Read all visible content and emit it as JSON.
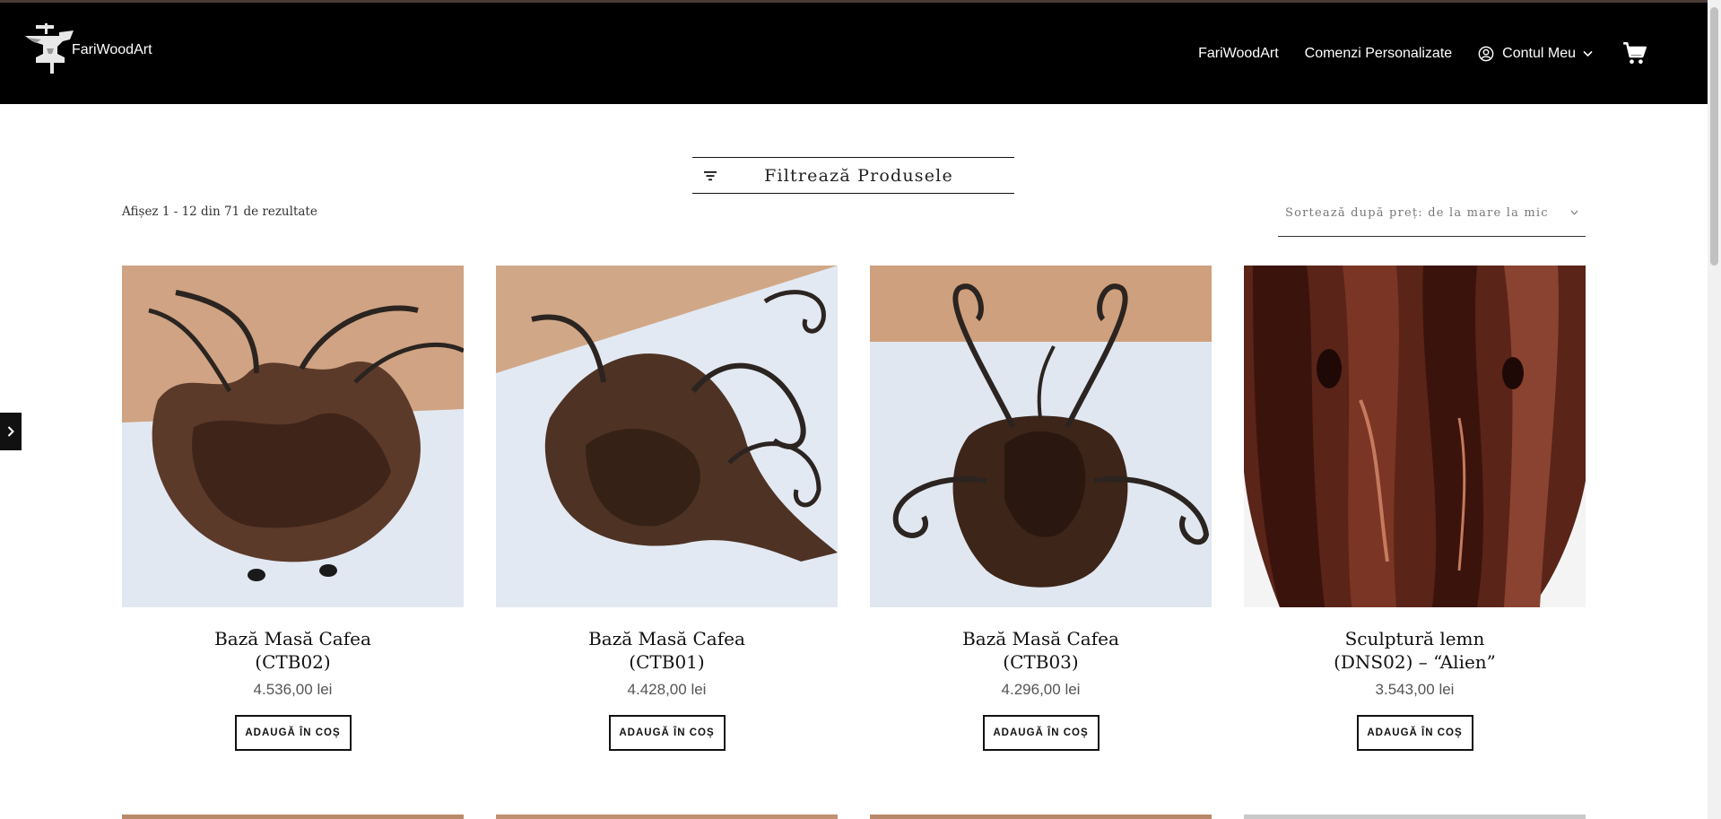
{
  "brand": {
    "name": "FariWoodArt"
  },
  "nav": {
    "items": [
      {
        "label": "FariWoodArt"
      },
      {
        "label": "Comenzi Personalizate"
      },
      {
        "label": "Contul Meu"
      }
    ]
  },
  "toolbar": {
    "filter_label": "Filtrează Produsele",
    "result_count": "Afișez 1 - 12 din 71 de rezultate",
    "sort_label": "Sortează după preț: de la mare la mic"
  },
  "products": [
    {
      "title_line1": "Bază Masă Cafea",
      "title_line2": "(CTB02)",
      "price": "4.536,00 lei",
      "button": "ADAUGĂ ÎN COȘ"
    },
    {
      "title_line1": "Bază Masă Cafea",
      "title_line2": "(CTB01)",
      "price": "4.428,00 lei",
      "button": "ADAUGĂ ÎN COȘ"
    },
    {
      "title_line1": "Bază Masă Cafea",
      "title_line2": "(CTB03)",
      "price": "4.296,00 lei",
      "button": "ADAUGĂ ÎN COȘ"
    },
    {
      "title_line1": "Sculptură lemn",
      "title_line2": "(DNS02) – “Alien”",
      "price": "3.543,00 lei",
      "button": "ADAUGĂ ÎN COȘ"
    }
  ],
  "icons": {
    "logo": "anvil-logo-icon",
    "account": "user-circle-icon",
    "dropdown": "chevron-down-icon",
    "cart": "shopping-cart-icon",
    "filter": "filter-lines-icon",
    "sidebar_toggle": "chevron-right-icon"
  },
  "colors": {
    "header_bg": "#000000",
    "text": "#111111",
    "price": "#555555"
  }
}
